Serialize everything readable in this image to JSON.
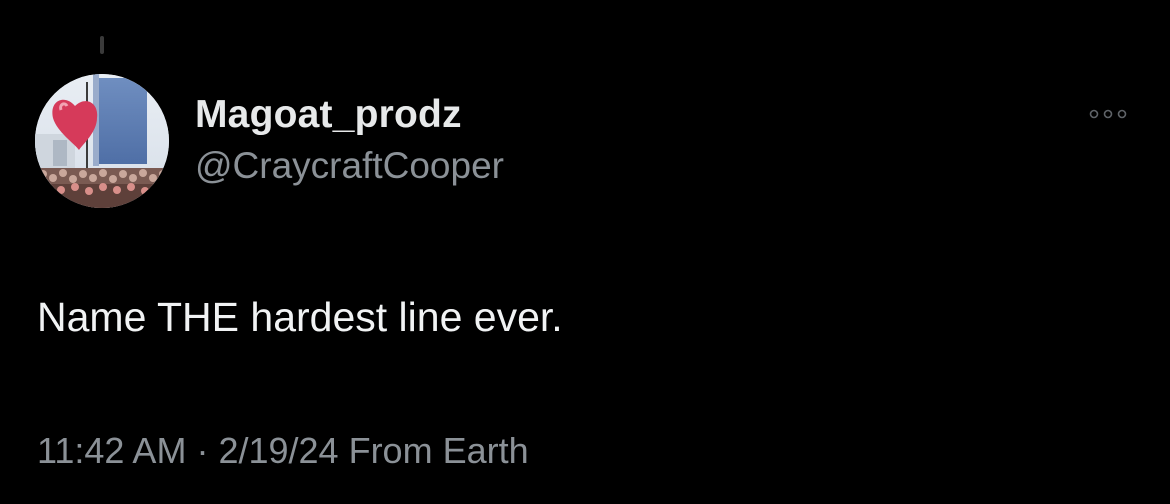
{
  "tweet": {
    "author": {
      "display_name": "Magoat_prodz",
      "handle": "@CraycraftCooper",
      "avatar_icon": "avatar-heart-balloon-photo"
    },
    "more_icon": "more-horizontal-icon",
    "text": "Name THE hardest line ever.",
    "meta": {
      "time": "11:42 AM",
      "separator": "·",
      "date": "2/19/24",
      "source": "From Earth"
    }
  },
  "colors": {
    "background": "#000000",
    "primary_text": "#e7e9ea",
    "secondary_text": "#8b9197"
  }
}
